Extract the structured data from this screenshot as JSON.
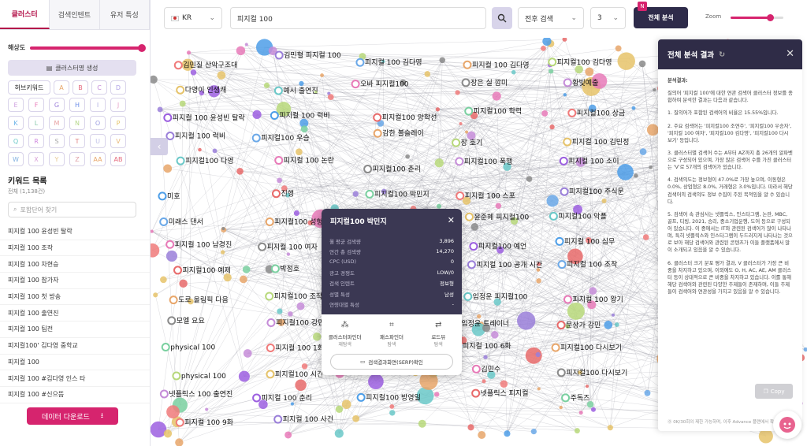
{
  "left_panel": {
    "tabs": [
      "클러스터",
      "검색인텐트",
      "유저 특성"
    ],
    "resolution_label": "해상도",
    "resolution_value": 1.0,
    "generate_button": "클러스터명 생성",
    "chip_hub": "허브키워드",
    "chips_row1": [
      "A",
      "B",
      "C",
      "D"
    ],
    "chips": [
      "E",
      "F",
      "G",
      "H",
      "I",
      "J",
      "K",
      "L",
      "M",
      "N",
      "O",
      "P",
      "Q",
      "R",
      "S",
      "T",
      "U",
      "V",
      "W",
      "X",
      "Y",
      "Z",
      "AA",
      "AB"
    ],
    "keyword_list_title": "키워드 목록",
    "keyword_count": "전체 (1,138건)",
    "search_placeholder": "포함단어 찾기",
    "keywords": [
      "피지컬 100 윤성빈 탈락",
      "피지컬 100 조작",
      "피지컬 100 차현승",
      "피지컬 100 참가자",
      "피지컬 100 첫 방송",
      "피지컬 100 출연진",
      "피지컬 100 팀전",
      "피지컬100' 김다영 중학교",
      "피지컬 100",
      "피지컬 100 #김다영 인스 타",
      "피지컬 100 #신으뜸"
    ],
    "download_button": "데이터 다운로드"
  },
  "topbar": {
    "country": "KR",
    "search_value": "피지컬 100",
    "search_mode": "전후 검색",
    "depth": "3",
    "analyze_button": "전체 분석",
    "badge": "N",
    "zoom_label": "Zoom",
    "zoom_value": 0.75
  },
  "popup": {
    "title": "피지컬100 박민지",
    "rows": [
      {
        "k": "월 평균 검색량",
        "v": "3,896"
      },
      {
        "k": "연간 총 검색량",
        "v": "14,270"
      },
      {
        "k": "CPC (USD)",
        "v": "0"
      },
      {
        "k": "광고 경쟁도",
        "v": "LOW/0"
      },
      {
        "k": "검색 인텐트",
        "v": "정보형"
      },
      {
        "k": "성별 특성",
        "v": "남성"
      },
      {
        "k": "연령대별 특성",
        "v": "-"
      }
    ],
    "actions": [
      {
        "label": "클러스터파인더",
        "sub": "재탐색"
      },
      {
        "label": "패스파인더",
        "sub": "탐색"
      },
      {
        "label": "로드뷰",
        "sub": "탐색"
      }
    ],
    "serp_button": "검색결과화면(SERP)확인"
  },
  "right_panel": {
    "title": "전체 분석 결과",
    "heading": "분석결과:",
    "paragraphs": [
      "질의어 '피지컬 100'에 대한 연관 검색어 클러스터 정보를 종합하여 분석한 결과는 다음과 같습니다.",
      "1. 질의어가 포함된 검색어의 비율은 15.55%입니다.",
      "2. 주요 검색어는 '피지컬100 조연주', '피지컬100 우승자', '피지컬 100 여자', '피지컬100 김다영', '피지컬100 다시보기' 등입니다.",
      "3. 클러스터별 검색어 수는 A부터 AZ까지 총 26개의 알파벳으로 구성되어 있으며, 가장 많은 검색어 수를 가진 클러스터는 'V'로 57개의 검색어가 있습니다.",
      "4. 검색의도는 정보형이 47.0%로 가장 높으며, 이동형은 0.0%, 상업형은 8.0%, 거래형은 3.0%입니다. 따라서 해당 검색어의 검색의도 정보 수집이 주된 목적임을 알 수 있습니다.",
      "5. 검색어 속 관심사는 넷플릭스, 인스타그램, 논란, MBC, 골프, 티빙, 2021, 승리, 중소기업운행, 도어 등으로 구성되어 있습니다. 이 중에서는 IT와 관련된 검색어가 많이 나타나며, 특히 넷플릭스와 인스타그램이 두드러지게 나타나는 것으로 보아 해당 검색어와 관련된 콘텐츠가 이들 플랫폼에서 많이 소개되고 있음을 알 수 있습니다.",
      "6. 클러스터 크기 분포 평가 결과, V 클러스터가 가장 큰 비중을 차지하고 있으며, 이외에도 O, H, AC, AE, AM 클러스터 등이 상대적으로 큰 비중을 차지하고 있습니다. 이를 통해 해당 검색어와 관련된 다양한 주제들이 존재하며, 이들 주제들이 검색어와 연관성을 가지고 있음을 알 수 있습니다."
    ],
    "copy_button": "Copy",
    "footer": "⓪ 0K/30회의 제한 가능하며, 이후 Advance 플랜에서 확인할 수"
  },
  "graph": {
    "labels": [
      "김민질 산악구조대",
      "김민혈 피지컬 100",
      "피지컬 100 김다영",
      "피지컬 100 김다영",
      "피지컬100 김다영",
      "다영이 인생캐",
      "예시 출연진",
      "오바 피지컬100",
      "장은 실 깜미",
      "황빛예출",
      "피지컬 100 윤성빈 탈락",
      "피지컬 100 럭비",
      "피지컬100 양학선",
      "피지컬100 학력",
      "피지컬100 상금",
      "피지컬 100 럭비",
      "피지컬100 우승",
      "감한 볼슬레이",
      "장 호기",
      "피지컬 100 김민정",
      "피지컬100 다영",
      "피지컬 100 논란",
      "피지컬100 춘리",
      "피지컬100 폭행",
      "피지컬 100 소이",
      "미호",
      "진행",
      "피지컬100 박민지",
      "피지컬 100 스포",
      "피지컬100 주식문",
      "미래스 댄서",
      "피지컬100 성형인",
      "마라클 피지컬100",
      "윤준혜 피지컬100",
      "피지컬100 악플",
      "피지컬 100 남경진",
      "피지컬 100 여자",
      "피지컬 100 장성민",
      "피지컬100 예언",
      "피지컬 100 심무",
      "피지컬100 예제",
      "박정호",
      "춘리 로아 다",
      "피지컬 100 공개 시간",
      "피지컬 100 조작",
      "도로 올림픽 다음",
      "피지컬100 조작",
      "피지컬100 출연진",
      "임정운 피지컬100",
      "피지컬 100 왕기",
      "모엘 요요",
      "피지컬100 강민",
      "피지컬 100 데시",
      "임정윤 트레이너",
      "문상가 강민",
      "physical 100",
      "피지컬 100 1화",
      "임정운 인스타",
      "피지컬 100 6화",
      "피지컬100 다시보기",
      "physical 100",
      "피지컬100 시간",
      "피지컬 100 공개 시간",
      "김민수",
      "피지컬100 다시보기",
      "넷플릭스 100 출연진",
      "피지컬 100 춘리",
      "피지컬100 방영일",
      "넷플릭스 피지컬",
      "주독즈",
      "피지컬 100 9화",
      "피지컬 100 사건"
    ]
  }
}
